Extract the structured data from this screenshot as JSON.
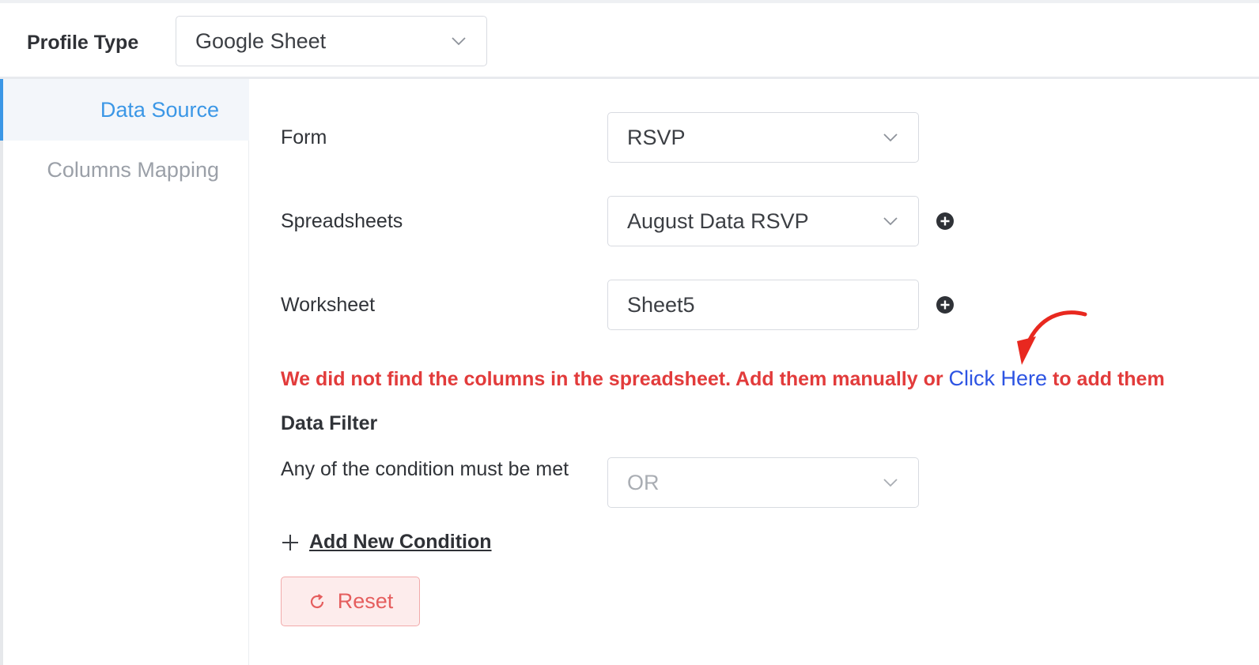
{
  "header": {
    "profile_type_label": "Profile Type",
    "profile_type_value": "Google Sheet"
  },
  "sidebar": {
    "items": [
      {
        "label": "Data Source",
        "active": true
      },
      {
        "label": "Columns Mapping",
        "active": false
      }
    ]
  },
  "form": {
    "form_label": "Form",
    "form_value": "RSVP",
    "spreadsheets_label": "Spreadsheets",
    "spreadsheets_value": "August Data RSVP",
    "worksheet_label": "Worksheet",
    "worksheet_value": "Sheet5"
  },
  "message": {
    "text": "We did not find the columns in the spreadsheet. Add them manually or ",
    "link": "Click Here",
    "suffix": " to add them"
  },
  "filter": {
    "title": "Data Filter",
    "condition_label": "Any of the condition must be met",
    "condition_value": "OR",
    "add_condition": "Add New Condition",
    "reset": "Reset"
  },
  "colors": {
    "accent": "#3b97e6",
    "error": "#e23b3b",
    "link": "#2d54e3",
    "reset_border": "#f2aaaa",
    "reset_bg": "#fdecec"
  },
  "icons": [
    "chevron-down-icon",
    "plus-circle-icon",
    "arrow-annotation-icon",
    "plus-icon",
    "refresh-icon"
  ]
}
